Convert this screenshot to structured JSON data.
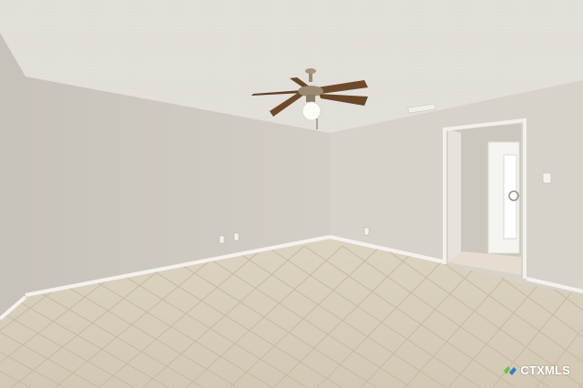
{
  "scene": {
    "colors": {
      "ceiling": "#e3e0da",
      "left_wall": "#d3cec5",
      "back_wall": "#d9d5cd",
      "right_wall": "#d6d2ca",
      "floor": "#d9cfbd",
      "grout": "#c4b9a6",
      "baseboard": "#f4f2ee",
      "fan_blade": "#6e4a2c",
      "fan_metal": "#9b8a72",
      "door_frame": "#f2f0ea",
      "hall_wall": "#cfcac0",
      "entry_door": "#f5f4f0"
    }
  },
  "watermark": {
    "text": "CTXMLS",
    "icon": "ctxmls-logo-icon",
    "colors": {
      "green": "#6cc04a",
      "blue": "#2f7fc1"
    }
  }
}
